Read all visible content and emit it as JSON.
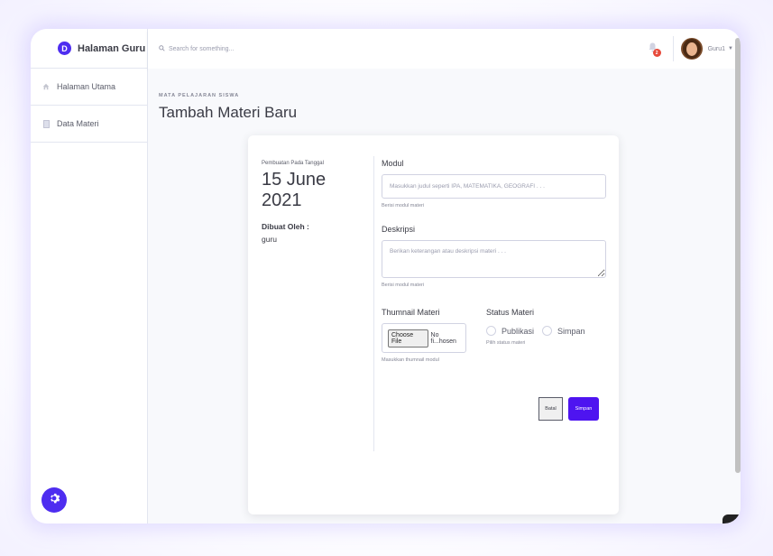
{
  "sidebar": {
    "brand": "Halaman Guru",
    "brand_logo": "D",
    "items": [
      {
        "label": "Halaman Utama",
        "icon": "home-icon"
      },
      {
        "label": "Data Materi",
        "icon": "document-icon"
      }
    ]
  },
  "topbar": {
    "search_placeholder": "Search for something...",
    "notification_count": "2",
    "user_name": "Guru1"
  },
  "page": {
    "eyebrow": "MATA PELAJARAN SISWA",
    "title": "Tambah Materi Baru"
  },
  "card": {
    "created_on_label": "Pembuatan Pada Tanggal",
    "date": "15 June 2021",
    "created_by_label": "Dibuat Oleh :",
    "created_by_value": "guru"
  },
  "form": {
    "modul_label": "Modul",
    "modul_placeholder": "Masukkan judul seperti IPA, MATEMATIKA, GEOGRAFI . . .",
    "modul_help": "Berisi modul materi",
    "deskripsi_label": "Deskripsi",
    "deskripsi_placeholder": "Berikan keterangan atau deskripsi materi . . .",
    "deskripsi_help": "Berisi modul materi",
    "thumbnail_label": "Thumnail Materi",
    "file_button": "Choose File",
    "file_status": "No fi...hosen",
    "thumbnail_help": "Masukkan thumnail modul",
    "status_label": "Status Materi",
    "status_options": [
      "Publikasi",
      "Simpan"
    ],
    "status_help": "Pilih status materi",
    "cancel_label": "Batal",
    "save_label": "Simpan"
  },
  "colors": {
    "accent": "#4e14f0",
    "badge": "#e74a3b"
  }
}
